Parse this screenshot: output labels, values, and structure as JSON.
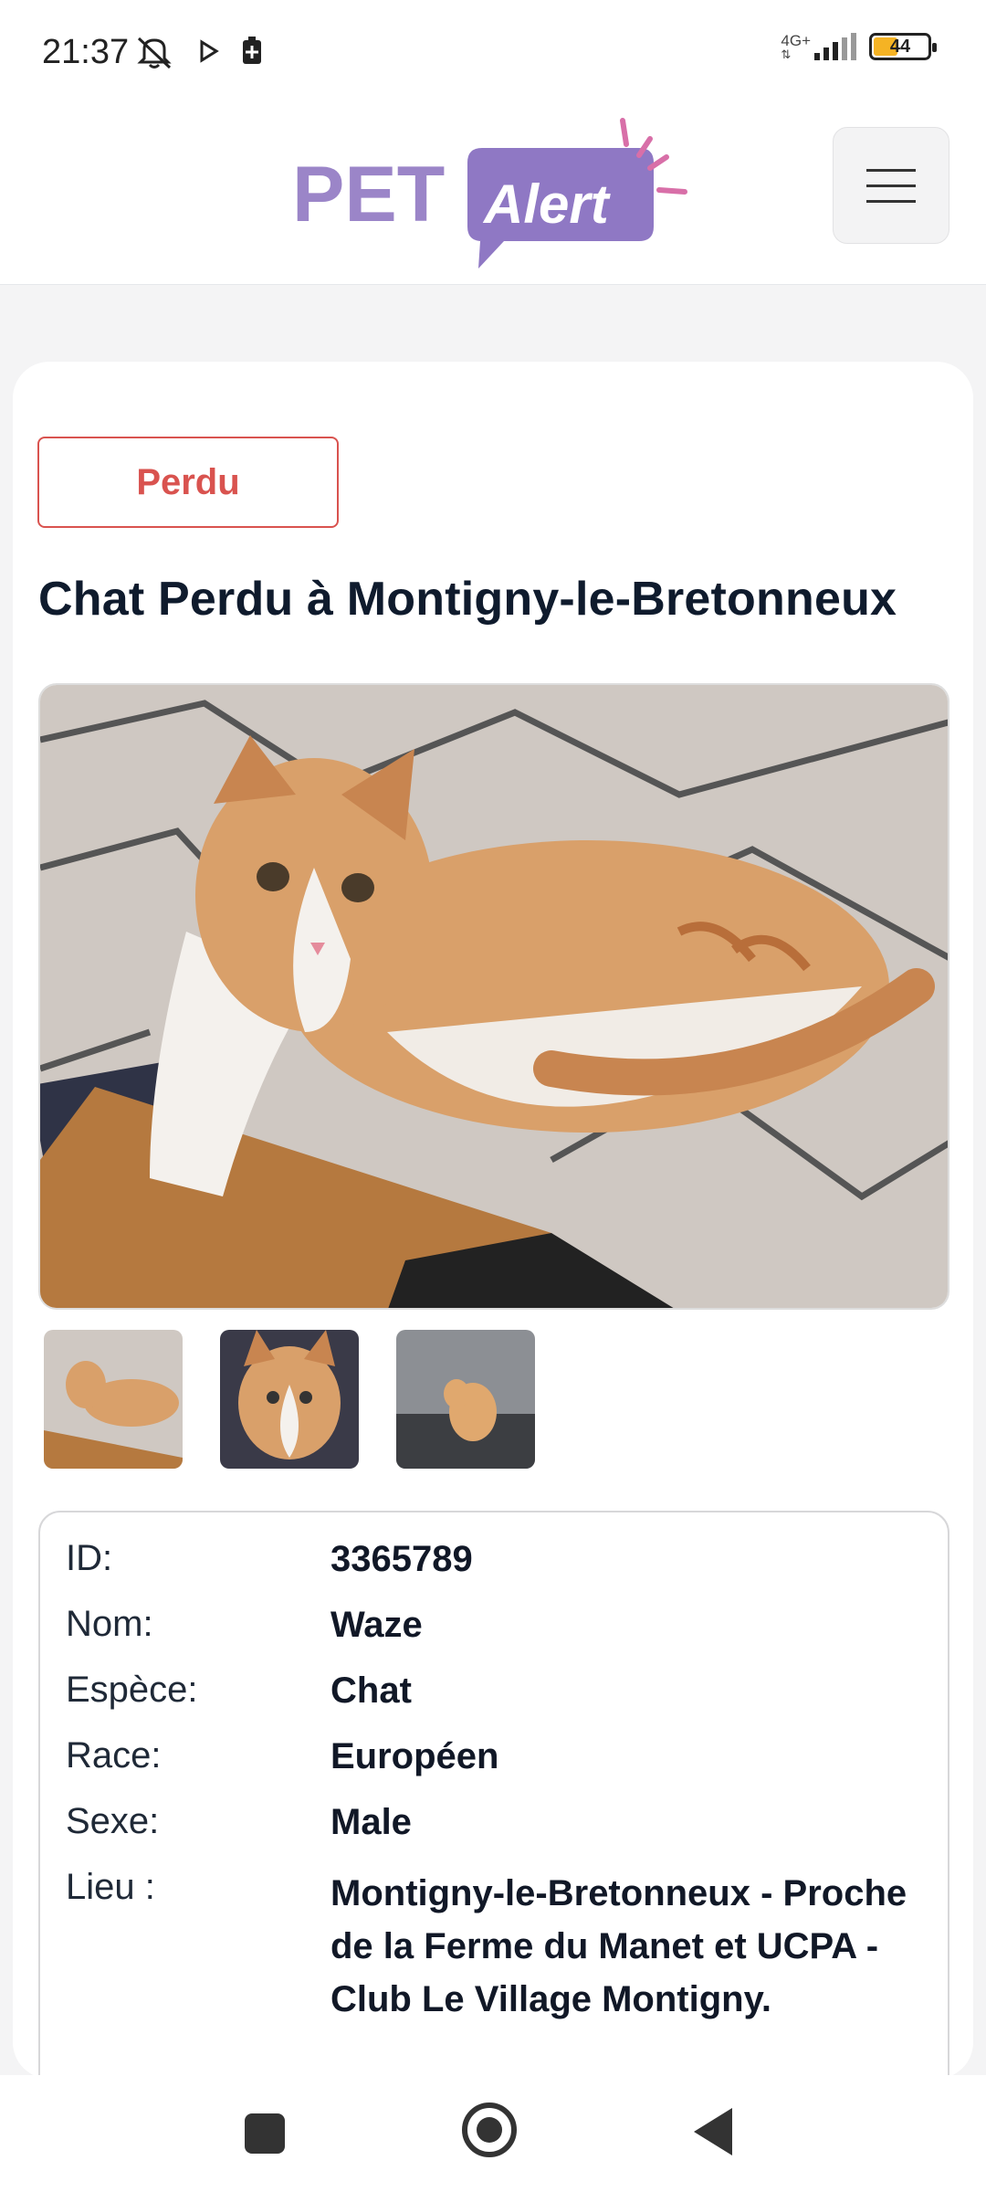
{
  "status_bar": {
    "time": "21:37",
    "network": "4G+",
    "battery_level": "44",
    "battery_fraction": 0.44
  },
  "header": {
    "logo_text_pet": "PET",
    "logo_text_alert": "Alert",
    "brand_colors": {
      "pet": "#9b85c8",
      "alert": "#8f78c4",
      "rays": "#d86fa8"
    }
  },
  "listing": {
    "status_badge": "Perdu",
    "title": "Chat Perdu à Montigny-le-Bretonneux",
    "thumbnail_count": 3
  },
  "details": {
    "rows": [
      {
        "label": "ID:",
        "value": "3365789"
      },
      {
        "label": "Nom:",
        "value": "Waze"
      },
      {
        "label": "Espèce:",
        "value": "Chat"
      },
      {
        "label": "Race:",
        "value": "Européen"
      },
      {
        "label": "Sexe:",
        "value": "Male"
      },
      {
        "label": "Lieu :",
        "value": "Montigny-le-Bretonneux -  Proche de la Ferme du Manet et UCPA - Club Le Village Montigny."
      }
    ]
  },
  "colors": {
    "lost_badge": "#d9534f",
    "title": "#0f1b2d"
  },
  "icons": [
    "mute-icon",
    "play-icon",
    "battery-saver-icon",
    "signal-icon",
    "battery-icon",
    "menu-icon",
    "nav-recents-icon",
    "nav-home-icon",
    "nav-back-icon"
  ]
}
